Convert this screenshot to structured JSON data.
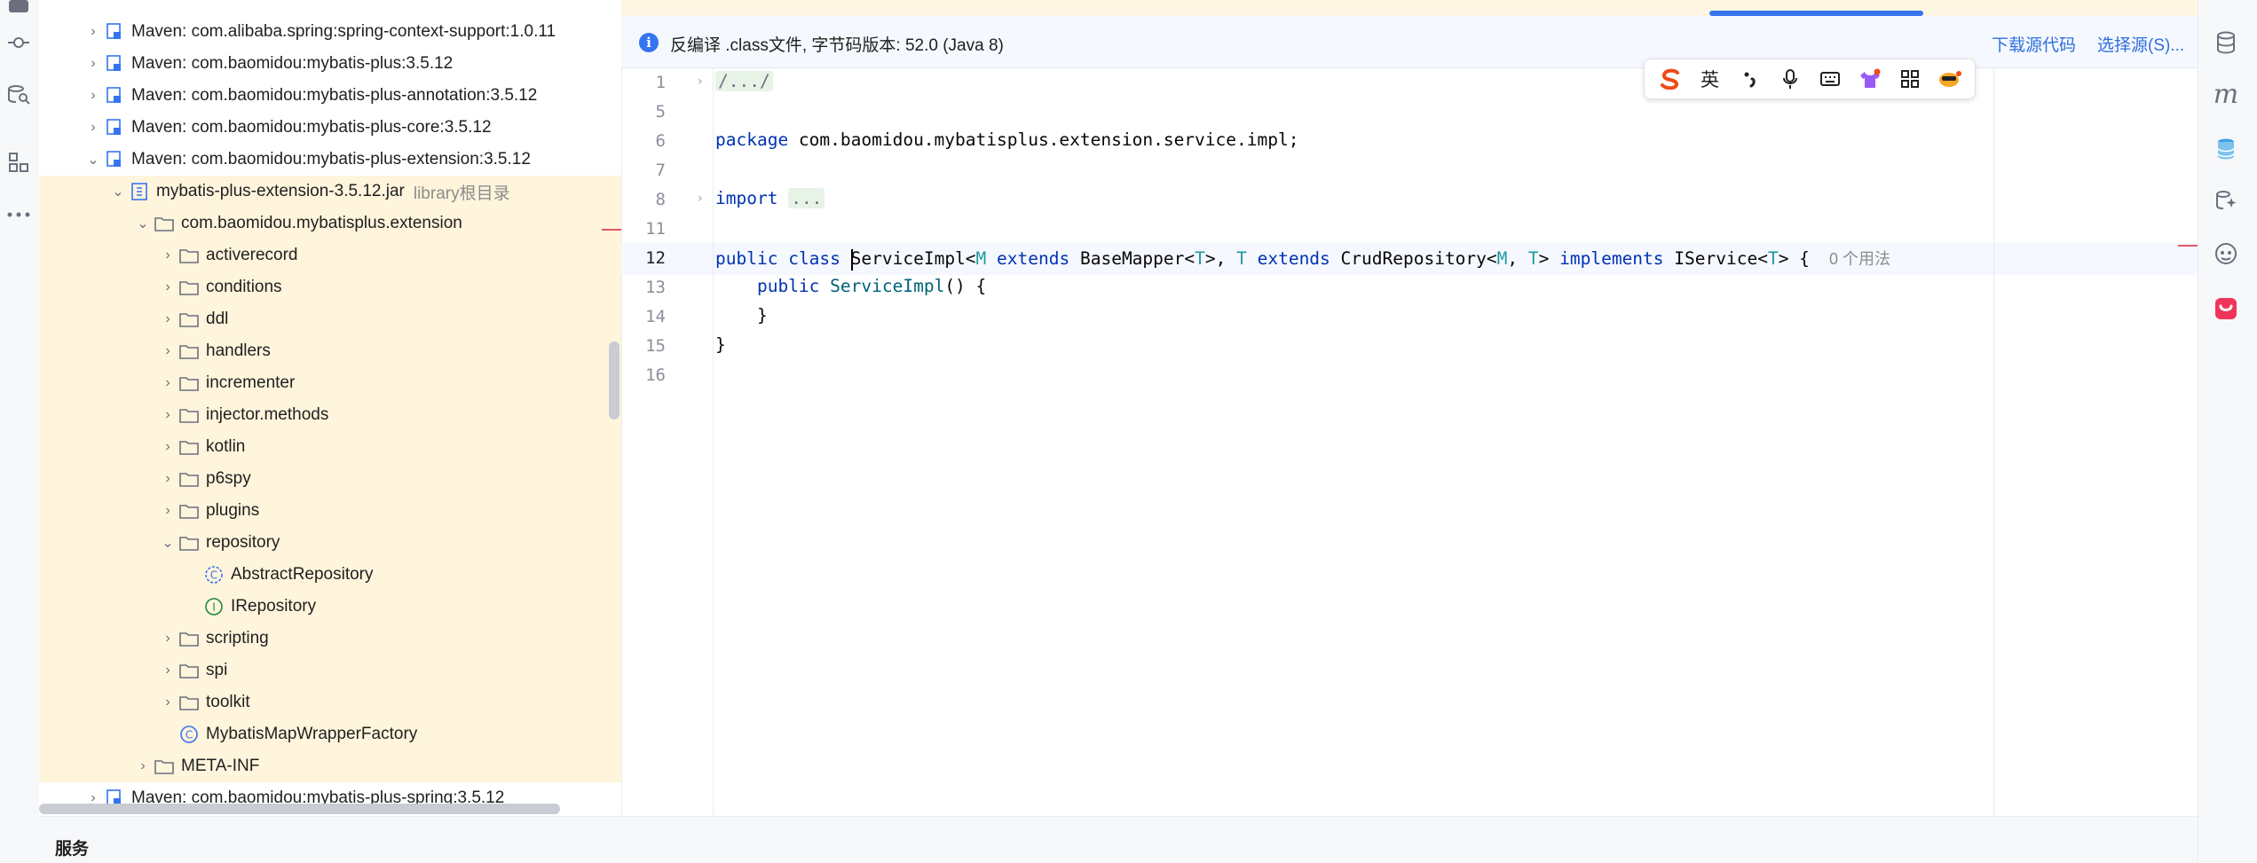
{
  "tree": {
    "rows": [
      {
        "label": "Maven: com.alibaba.spring:spring-context-support:1.0.11",
        "muted": ""
      },
      {
        "label": "Maven: com.baomidou:mybatis-plus:3.5.12",
        "muted": ""
      },
      {
        "label": "Maven: com.baomidou:mybatis-plus-annotation:3.5.12",
        "muted": ""
      },
      {
        "label": "Maven: com.baomidou:mybatis-plus-core:3.5.12",
        "muted": ""
      },
      {
        "label": "Maven: com.baomidou:mybatis-plus-extension:3.5.12",
        "muted": ""
      },
      {
        "label": "mybatis-plus-extension-3.5.12.jar",
        "muted": "library根目录"
      },
      {
        "label": "com.baomidou.mybatisplus.extension",
        "muted": ""
      },
      {
        "label": "activerecord",
        "muted": ""
      },
      {
        "label": "conditions",
        "muted": ""
      },
      {
        "label": "ddl",
        "muted": ""
      },
      {
        "label": "handlers",
        "muted": ""
      },
      {
        "label": "incrementer",
        "muted": ""
      },
      {
        "label": "injector.methods",
        "muted": ""
      },
      {
        "label": "kotlin",
        "muted": ""
      },
      {
        "label": "p6spy",
        "muted": ""
      },
      {
        "label": "plugins",
        "muted": ""
      },
      {
        "label": "repository",
        "muted": ""
      },
      {
        "label": "AbstractRepository",
        "muted": ""
      },
      {
        "label": "IRepository",
        "muted": ""
      },
      {
        "label": "scripting",
        "muted": ""
      },
      {
        "label": "spi",
        "muted": ""
      },
      {
        "label": "toolkit",
        "muted": ""
      },
      {
        "label": "MybatisMapWrapperFactory",
        "muted": ""
      },
      {
        "label": "META-INF",
        "muted": ""
      },
      {
        "label": "Maven: com.baomidou:mybatis-plus-spring:3.5.12",
        "muted": ""
      }
    ]
  },
  "banner": {
    "text": "反编译 .class文件, 字节码版本: 52.0 (Java 8)",
    "download": "下载源代码",
    "choose": "选择源(S)..."
  },
  "gutter": {
    "lines": [
      "1",
      "5",
      "6",
      "7",
      "8",
      "11",
      "12",
      "13",
      "14",
      "15",
      "16"
    ]
  },
  "code": {
    "l1": "/.../",
    "l6_kw": "package",
    "l6_rest": " com.baomidou.mybatisplus.extension.service.impl;",
    "l8_kw": "import",
    "l8_dots": "...",
    "l12": {
      "public": "public",
      "class": "class",
      "name": "ServiceImpl",
      "lt1": "<",
      "m": "M",
      "extends1": "extends",
      "base": "BaseMapper<",
      "t1": "T",
      "gt1": ">, ",
      "t2": "T",
      "extends2": "extends",
      "crud": "CrudRepository<",
      "m2": "M",
      "comma": ", ",
      "t3": "T",
      "gt2": "> ",
      "implements": "implements",
      "iservice": "IService<",
      "t4": "T",
      "gt3": "> {",
      "hint": "0 个用法"
    },
    "l13_kw": "public",
    "l13_name": "ServiceImpl",
    "l13_rest": "() {",
    "l14": "}",
    "l15": "}"
  },
  "ime": {
    "lang": "英"
  },
  "bottom": {
    "services": "服务"
  },
  "colors": {
    "keyword": "#0033b3",
    "type_param": "#20999d",
    "method": "#00627a",
    "link": "#2f6fde",
    "selection_bg": "#fff4dc",
    "accent": "#3574f0"
  },
  "icons": {
    "left_strip": [
      "commit-icon",
      "database-search-icon",
      "structure-icon",
      "more-icon"
    ],
    "right_strip": [
      "database-icon",
      "maven-icon",
      "database-stack-icon",
      "ai-assistant-icon",
      "copilot-icon",
      "plugin-red-icon"
    ]
  }
}
